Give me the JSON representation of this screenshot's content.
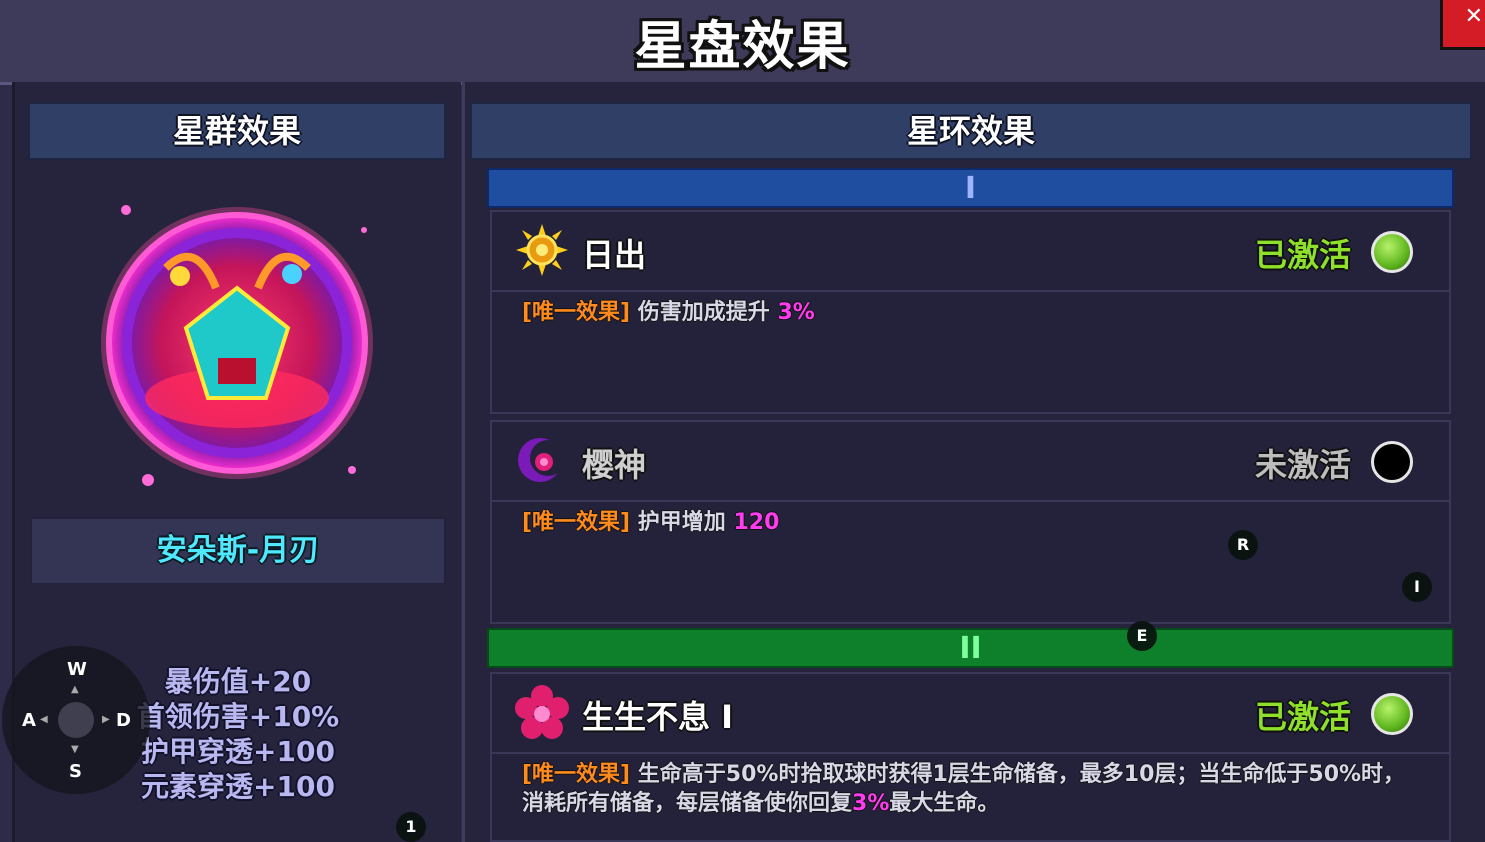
{
  "title": "星盘效果",
  "close_icon": "close-icon",
  "left": {
    "header": "星群效果",
    "constellation_name": "安朵斯-月刃",
    "stats": [
      "暴伤值+20",
      "首领伤害+10%",
      "护甲穿透+100",
      "元素穿透+100"
    ]
  },
  "right": {
    "header": "星环效果",
    "tiers": [
      "I",
      "II"
    ],
    "effects": [
      {
        "name": "日出",
        "status": "已激活",
        "active": true,
        "icon": "sun-icon",
        "tag": "[唯一效果]",
        "desc_pre": "伤害加成提升 ",
        "desc_val": "3%",
        "desc_post": ""
      },
      {
        "name": "樱神",
        "status": "未激活",
        "active": false,
        "icon": "crescent-blossom-icon",
        "tag": "[唯一效果]",
        "desc_pre": "护甲增加 ",
        "desc_val": "120",
        "desc_post": ""
      },
      {
        "name": "生生不息 I",
        "status": "已激活",
        "active": true,
        "icon": "flower-icon",
        "tag": "[唯一效果]",
        "desc_pre": "生命高于50%时拾取球时获得1层生命储备，最多10层；当生命低于50%时，消耗所有储备，每层储备使你回复",
        "desc_val": "3%",
        "desc_post": "最大生命。"
      }
    ]
  },
  "controls": {
    "up": "W",
    "left": "A",
    "right": "D",
    "down": "S",
    "hints": [
      "R",
      "I",
      "E",
      "1"
    ]
  },
  "colors": {
    "active_status": "#8ee02a",
    "inactive_status": "#bdbdbd",
    "tag": "#ff8a1e",
    "highlight": "#ff3cf0",
    "tier1": "#1f4ea0",
    "tier2": "#0e7f2b",
    "constellation_name": "#4ee8ff"
  }
}
